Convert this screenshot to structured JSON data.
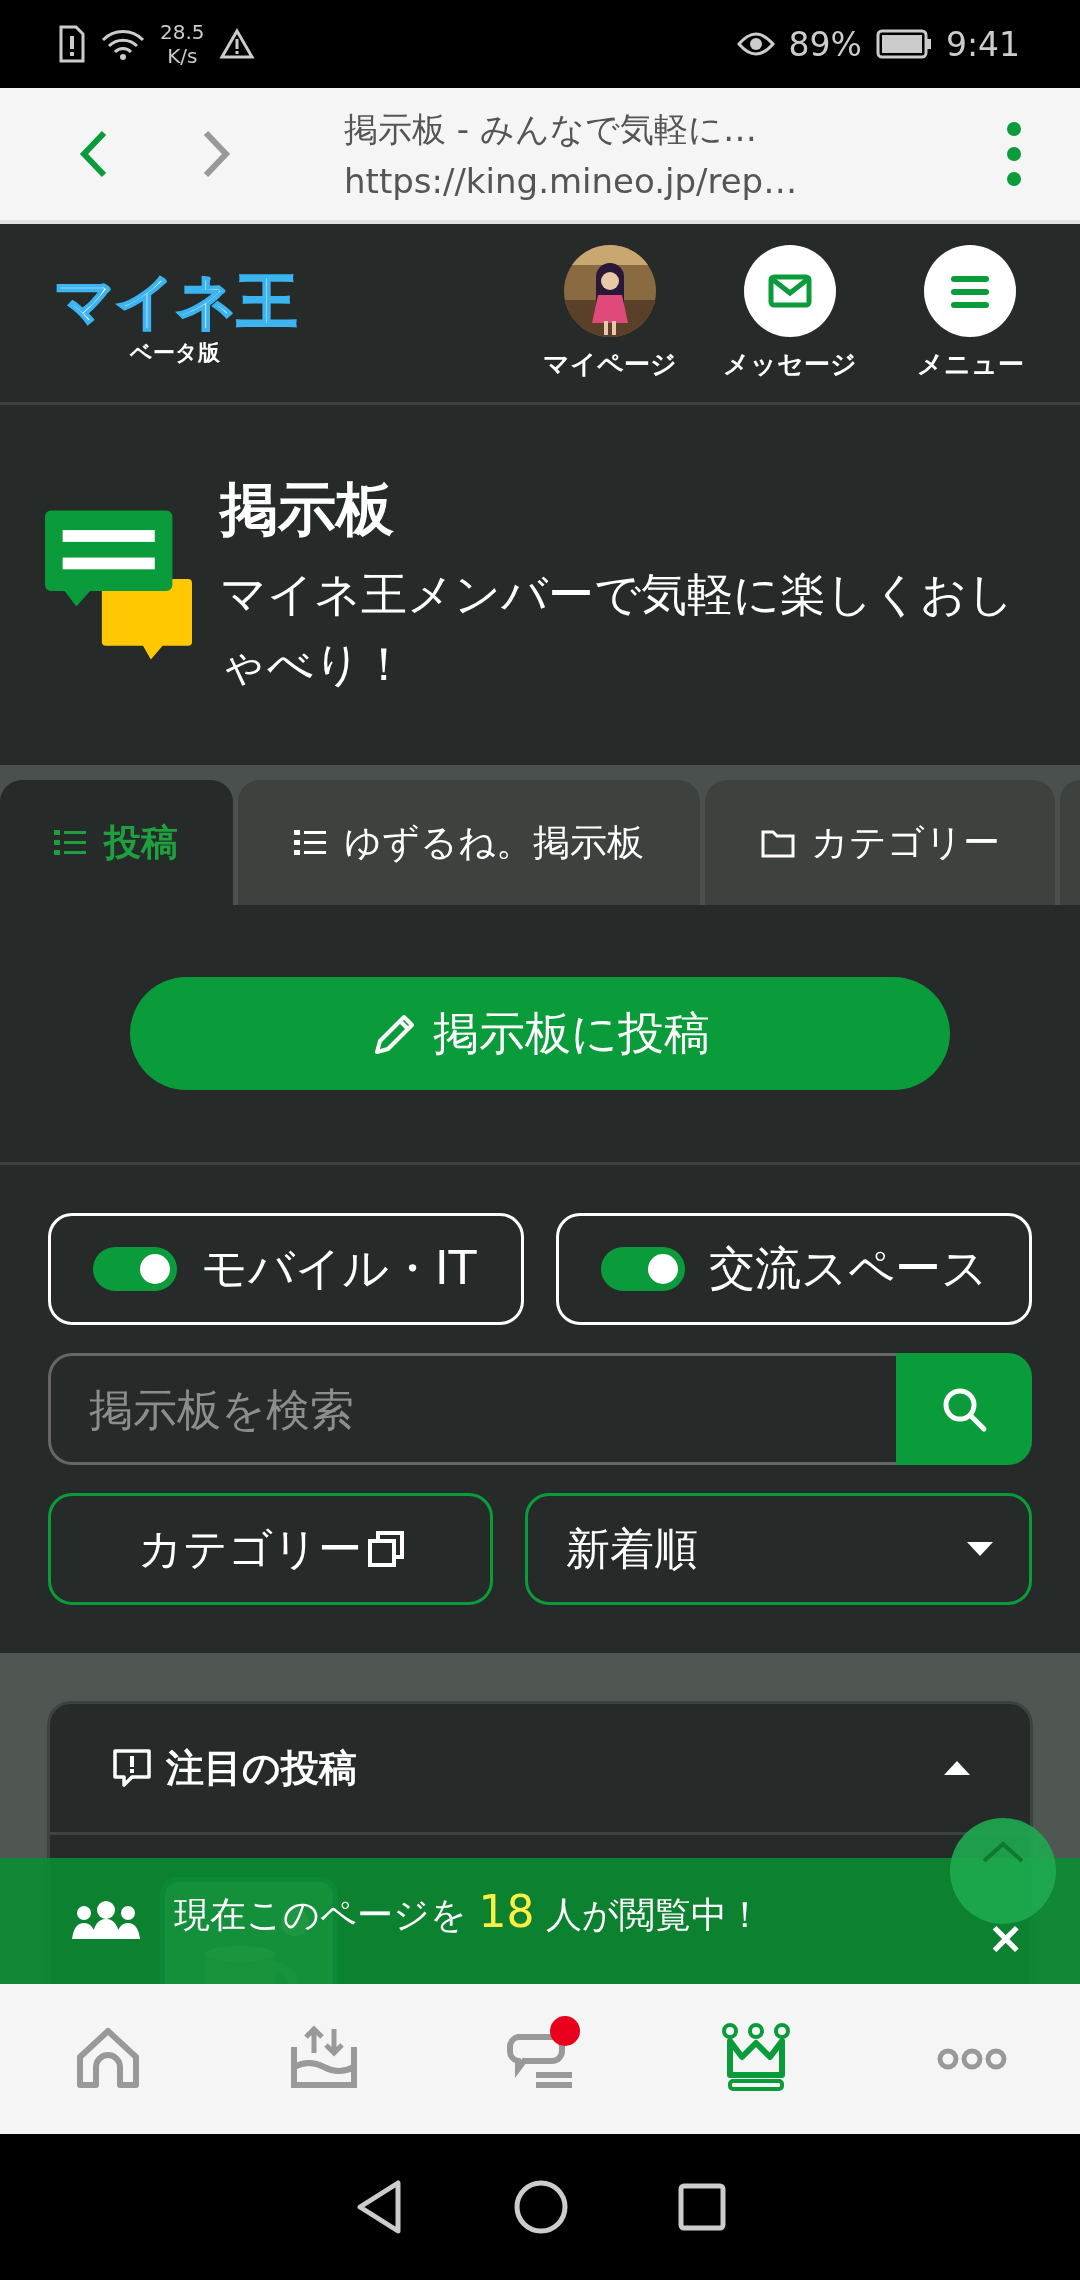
{
  "status_bar": {
    "speed_value": "28.5",
    "speed_unit": "K/s",
    "battery": "89%",
    "time": "9:41"
  },
  "browser": {
    "title": "掲示板 - みんなで気軽に…",
    "url": "https://king.mineo.jp/rep…"
  },
  "header": {
    "logo": "マイネ王",
    "logo_sub": "ベータ版",
    "nav": [
      {
        "kind": "avatar",
        "label": "マイページ"
      },
      {
        "kind": "mail",
        "label": "メッセージ"
      },
      {
        "kind": "menu",
        "label": "メニュー"
      }
    ]
  },
  "banner": {
    "title": "掲示板",
    "subtitle": "マイネ王メンバーで気軽に楽しくおしゃべり！"
  },
  "tabs": [
    {
      "label": "投稿",
      "selected": true
    },
    {
      "label": "ゆずるね。掲示板",
      "selected": false
    },
    {
      "label": "カテゴリー",
      "selected": false
    }
  ],
  "post_button": "掲示板に投稿",
  "filters": [
    {
      "label": "モバイル・IT",
      "on": true
    },
    {
      "label": "交流スペース",
      "on": true
    }
  ],
  "search": {
    "placeholder": "掲示板を検索"
  },
  "category_button": "カテゴリー",
  "sort": "新着順",
  "featured": {
    "title": "注目の投稿",
    "expanded": true
  },
  "viewers": {
    "prefix": "現在このページを",
    "count": "18",
    "suffix": "人が閲覧中！",
    "close": "×"
  },
  "bottom_nav": [
    {
      "kind": "home",
      "selected": false,
      "badge": false
    },
    {
      "kind": "upload",
      "selected": false,
      "badge": false
    },
    {
      "kind": "chat",
      "selected": false,
      "badge": true
    },
    {
      "kind": "crown",
      "selected": true,
      "badge": false
    },
    {
      "kind": "more",
      "selected": false,
      "badge": false
    }
  ]
}
